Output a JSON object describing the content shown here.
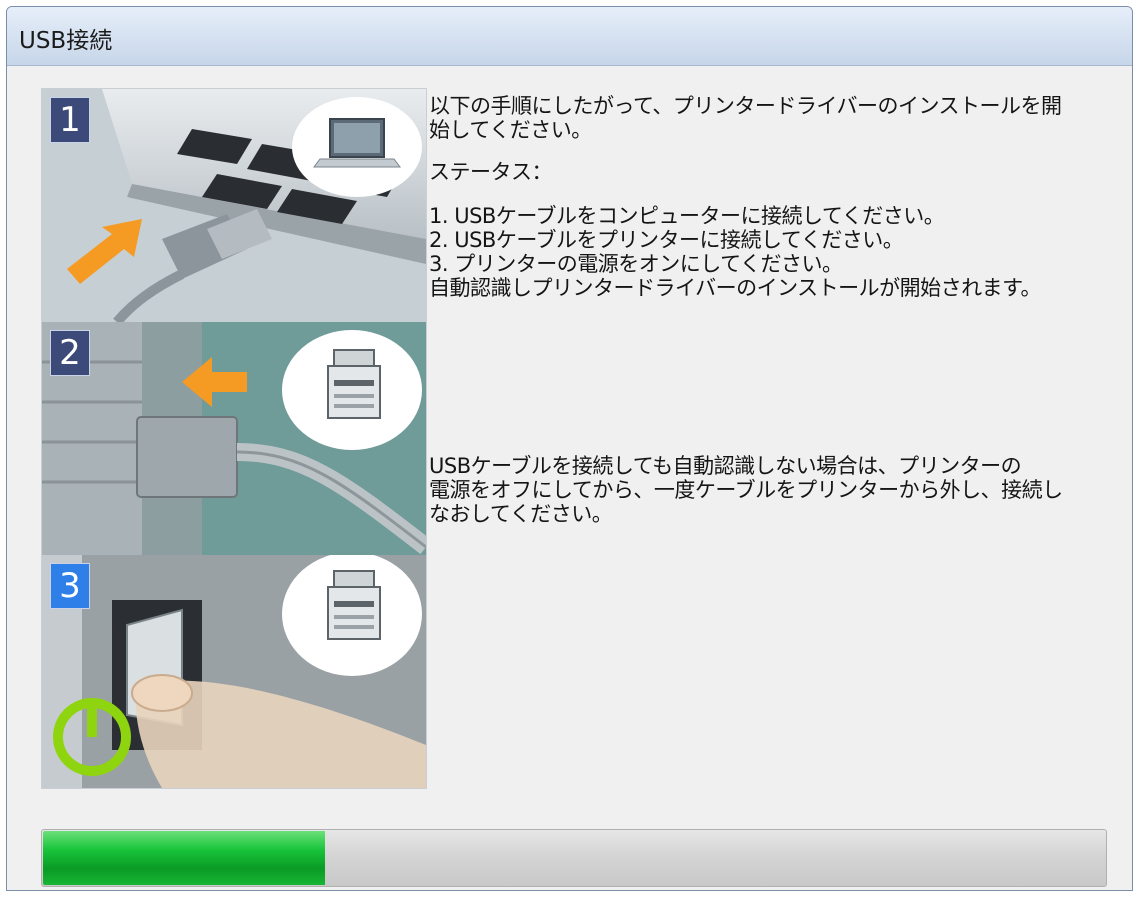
{
  "window": {
    "title": "USB接続"
  },
  "steps": [
    {
      "number": "1",
      "icon": "laptop-icon",
      "active": false
    },
    {
      "number": "2",
      "icon": "printer-icon",
      "active": false
    },
    {
      "number": "3",
      "icon": "printer-icon",
      "active": true
    }
  ],
  "instructions": {
    "intro_line1": "以下の手順にしたがって、プリンタードライバーのインストールを開",
    "intro_line2": "始してください。",
    "status_label": "ステータス：",
    "step1": "1. USBケーブルをコンピューターに接続してください。",
    "step2": "2. USBケーブルをプリンターに接続してください。",
    "step3": "3. プリンターの電源をオンにしてください。",
    "step_note": "自動認識しプリンタードライバーのインストールが開始されます。",
    "troubleshoot_line1": "USBケーブルを接続しても自動認識しない場合は、プリンターの",
    "troubleshoot_line2": "電源をオフにしてから、一度ケーブルをプリンターから外し、接続し",
    "troubleshoot_line3": "なおしてください。"
  },
  "progress": {
    "value": 0.265
  },
  "colors": {
    "badge": "#3b4a78",
    "badge_active": "#2f7fe8",
    "progress_fill": "#18c43a",
    "arrow": "#f59a23",
    "power": "#8ed40f"
  }
}
